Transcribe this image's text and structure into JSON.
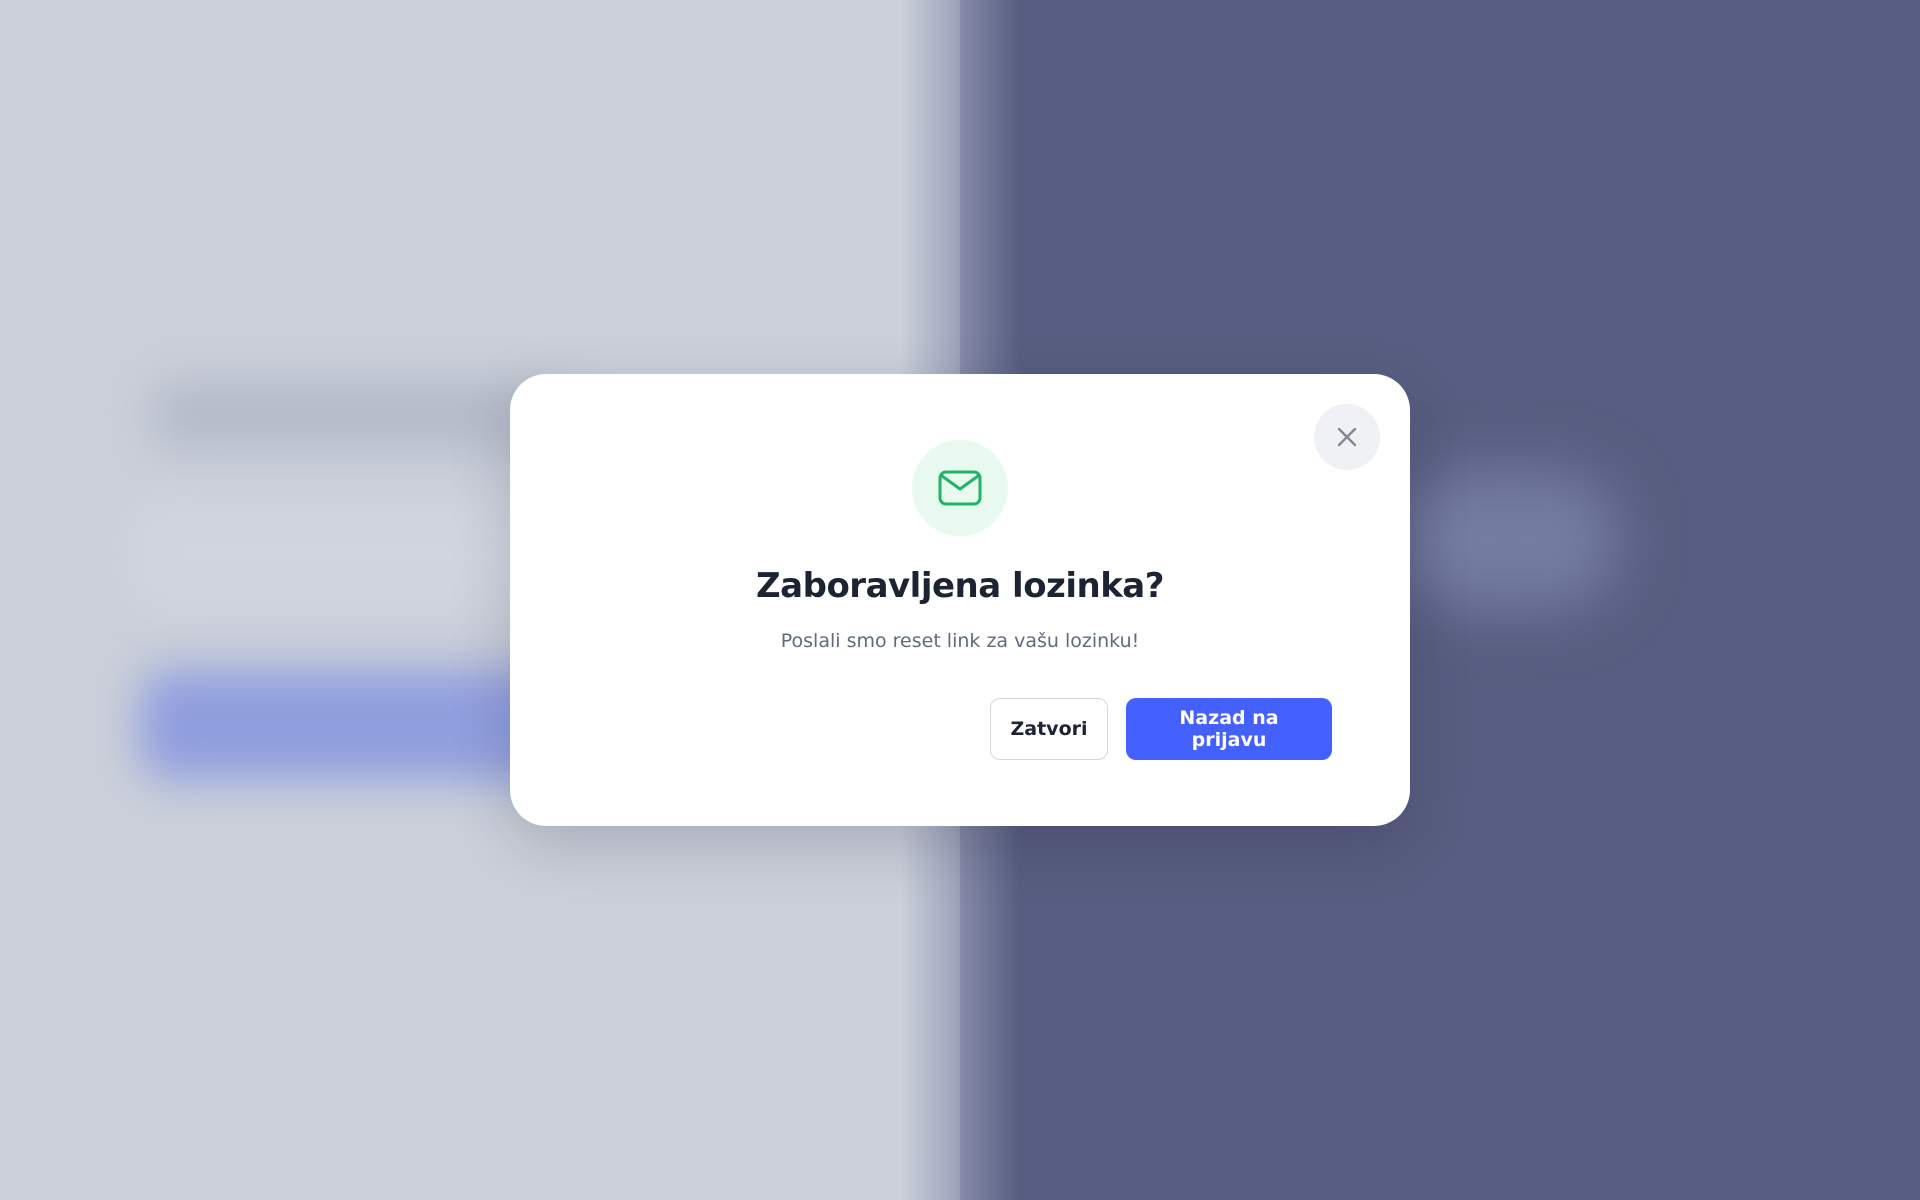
{
  "modal": {
    "title": "Zaboravljena lozinka?",
    "description": "Poslali smo reset link za vašu lozinku!",
    "icon": "mail-icon",
    "close_icon": "close-icon",
    "buttons": {
      "secondary_label": "Zatvori",
      "primary_label": "Nazad na prijavu"
    }
  },
  "colors": {
    "primary": "#4460ff",
    "icon_green": "#1fb46a",
    "icon_bg": "#e8faf0",
    "title": "#1c2433",
    "text_muted": "#5f6b7c",
    "overlay_left": "#cbd0da",
    "overlay_right": "#585e81"
  }
}
